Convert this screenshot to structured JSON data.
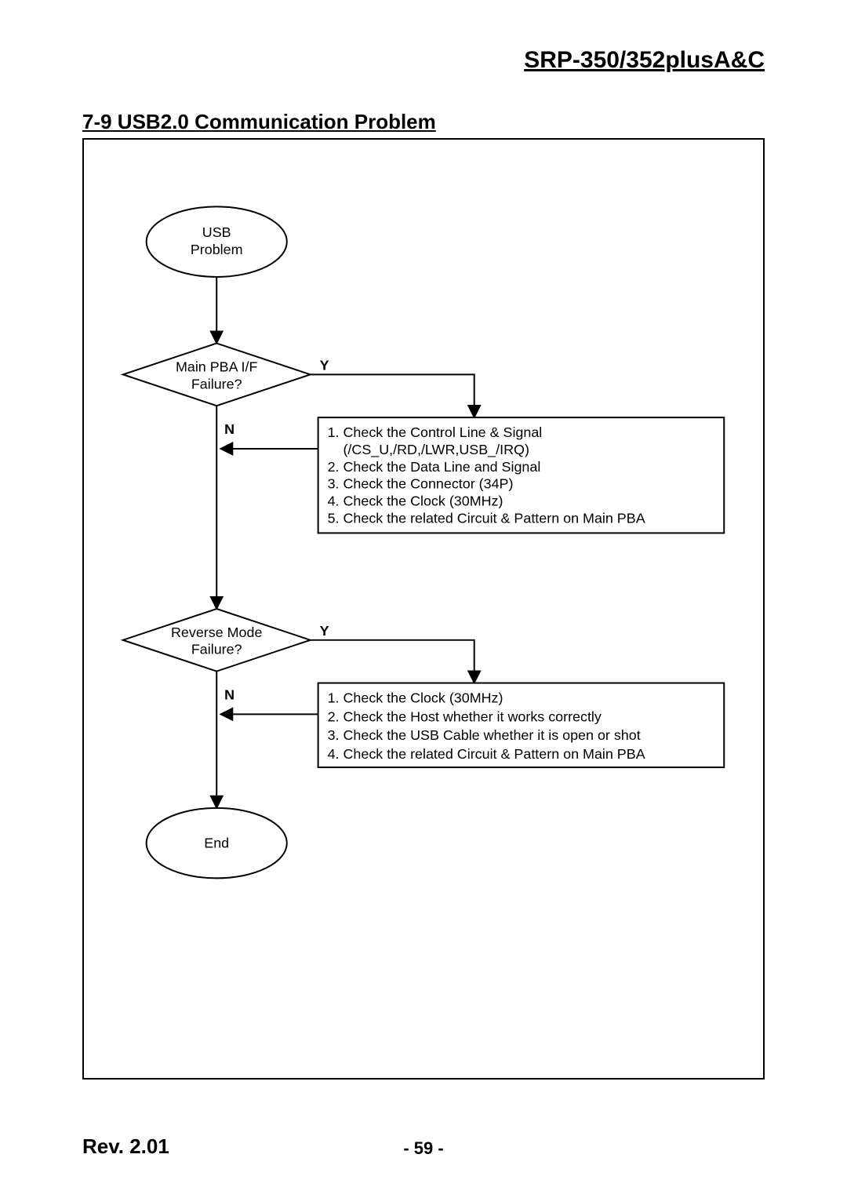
{
  "header": {
    "title": "SRP-350/352plusA&C"
  },
  "section": {
    "title": "7-9 USB2.0 Communication Problem"
  },
  "flow": {
    "start": {
      "line1": "USB",
      "line2": "Problem"
    },
    "d1": {
      "line1": "Main PBA I/F",
      "line2": "Failure?",
      "yes": "Y",
      "no": "N"
    },
    "p1": {
      "l1": "1. Check the Control Line & Signal",
      "l1b": "    (/CS_U,/RD,/LWR,USB_/IRQ)",
      "l2": "2. Check the Data Line and Signal",
      "l3": "3. Check the Connector (34P)",
      "l4": "4. Check the Clock (30MHz)",
      "l5": "5. Check the related Circuit & Pattern on Main PBA"
    },
    "d2": {
      "line1": "Reverse Mode",
      "line2": "Failure?",
      "yes": "Y",
      "no": "N"
    },
    "p2": {
      "l1": "1. Check the Clock (30MHz)",
      "l2": "2. Check the Host whether it works correctly",
      "l3": "3. Check the USB Cable whether it is open or shot",
      "l4": "4. Check the related Circuit & Pattern on Main PBA"
    },
    "end": {
      "label": "End"
    }
  },
  "footer": {
    "rev": "Rev. 2.01",
    "page": "- 59 -"
  },
  "chart_data": {
    "type": "flowchart",
    "nodes": [
      {
        "id": "start",
        "shape": "terminator",
        "text": "USB Problem"
      },
      {
        "id": "d1",
        "shape": "decision",
        "text": "Main PBA I/F Failure?"
      },
      {
        "id": "p1",
        "shape": "process",
        "text": "1. Check the Control Line & Signal (/CS_U,/RD,/LWR,USB_/IRQ) 2. Check the Data Line and Signal 3. Check the Connector (34P) 4. Check the Clock (30MHz) 5. Check the related Circuit & Pattern on Main PBA"
      },
      {
        "id": "d2",
        "shape": "decision",
        "text": "Reverse Mode Failure?"
      },
      {
        "id": "p2",
        "shape": "process",
        "text": "1. Check the Clock (30MHz) 2. Check the Host whether it works correctly 3. Check the USB Cable whether it is open or shot 4. Check the related Circuit & Pattern on Main PBA"
      },
      {
        "id": "end",
        "shape": "terminator",
        "text": "End"
      }
    ],
    "edges": [
      {
        "from": "start",
        "to": "d1"
      },
      {
        "from": "d1",
        "to": "p1",
        "label": "Y"
      },
      {
        "from": "d1",
        "to": "d2",
        "label": "N"
      },
      {
        "from": "p1",
        "to": "d2"
      },
      {
        "from": "d2",
        "to": "p2",
        "label": "Y"
      },
      {
        "from": "d2",
        "to": "end",
        "label": "N"
      },
      {
        "from": "p2",
        "to": "end"
      }
    ]
  }
}
